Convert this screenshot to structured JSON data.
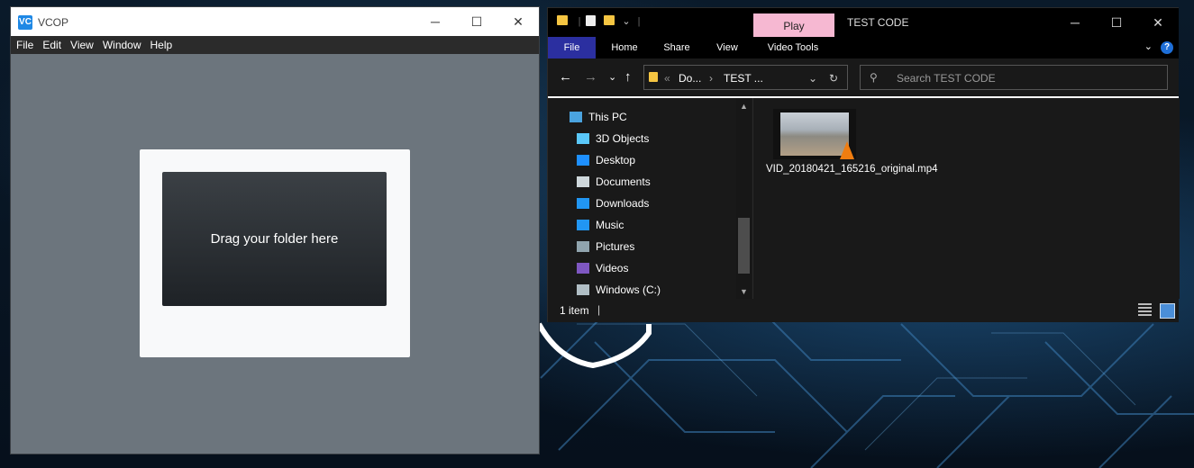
{
  "vcop": {
    "logo": "VC",
    "title": "VCOP",
    "controls": {
      "minimize": "─",
      "maximize": "☐",
      "close": "✕"
    },
    "menu": [
      "File",
      "Edit",
      "View",
      "Window",
      "Help"
    ],
    "drop_text": "Drag your folder here"
  },
  "explorer": {
    "quick_access_sep": "|",
    "play_tab": "Play",
    "caption": "TEST CODE",
    "controls": {
      "minimize": "─",
      "maximize": "☐",
      "close": "✕"
    },
    "ribbon": [
      "File",
      "Home",
      "Share",
      "View",
      "Video Tools"
    ],
    "ribbon_toggle": "⌄",
    "help": "?",
    "nav": {
      "back": "←",
      "forward": "→",
      "recent": "⌄",
      "up": "↑"
    },
    "address": {
      "chevrons": "«",
      "crumb1": "Do...",
      "sep": "›",
      "crumb2": "TEST ...",
      "dropdown": "⌄",
      "refresh": "↻"
    },
    "search": {
      "placeholder": "Search TEST CODE",
      "icon": "⚲"
    },
    "tree": [
      {
        "label": "This PC",
        "icon": "this-pc-icon",
        "color": "#4aa3df"
      },
      {
        "label": "3D Objects",
        "icon": "3d-objects-icon",
        "color": "#5ac8fa"
      },
      {
        "label": "Desktop",
        "icon": "desktop-icon",
        "color": "#1e90ff"
      },
      {
        "label": "Documents",
        "icon": "documents-icon",
        "color": "#cfd8dc"
      },
      {
        "label": "Downloads",
        "icon": "downloads-icon",
        "color": "#2196f3"
      },
      {
        "label": "Music",
        "icon": "music-icon",
        "color": "#2196f3"
      },
      {
        "label": "Pictures",
        "icon": "pictures-icon",
        "color": "#90a4ae"
      },
      {
        "label": "Videos",
        "icon": "videos-icon",
        "color": "#7e57c2"
      },
      {
        "label": "Windows (C:)",
        "icon": "drive-icon",
        "color": "#b0bec5"
      }
    ],
    "file": {
      "name": "VID_20180421_165216_original.mp4"
    },
    "status": {
      "count": "1 item",
      "sep": "|"
    }
  }
}
